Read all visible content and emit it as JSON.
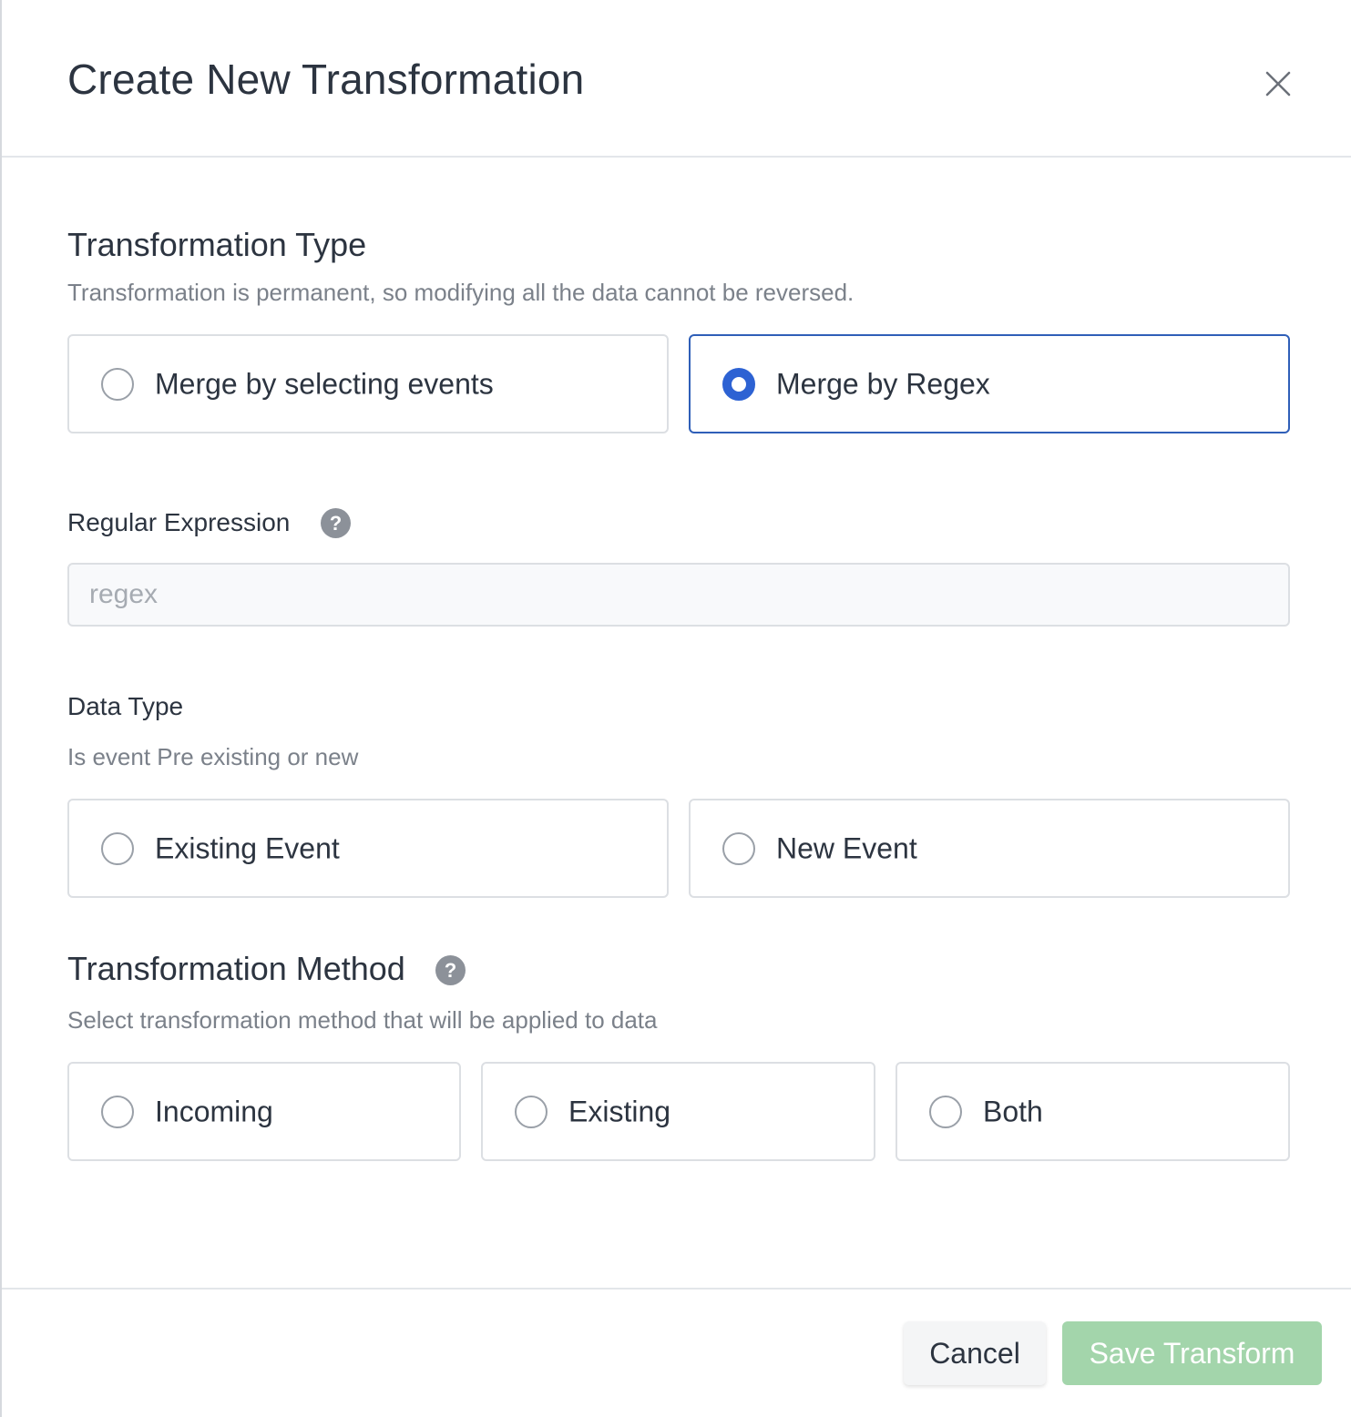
{
  "dialog": {
    "title": "Create New Transformation",
    "close_icon": "close-icon"
  },
  "transformation_type": {
    "title": "Transformation Type",
    "description": "Transformation is permanent, so modifying all the data cannot be reversed.",
    "options": [
      {
        "label": "Merge by selecting events",
        "selected": false
      },
      {
        "label": "Merge by Regex",
        "selected": true
      }
    ]
  },
  "regular_expression": {
    "label": "Regular Expression",
    "help_icon": "?",
    "placeholder": "regex",
    "value": ""
  },
  "data_type": {
    "label": "Data Type",
    "description": "Is event Pre existing or new",
    "options": [
      {
        "label": "Existing Event",
        "selected": false
      },
      {
        "label": "New Event",
        "selected": false
      }
    ]
  },
  "transformation_method": {
    "title": "Transformation Method",
    "help_icon": "?",
    "description": "Select transformation method that will be applied to data",
    "options": [
      {
        "label": "Incoming",
        "selected": false
      },
      {
        "label": "Existing",
        "selected": false
      },
      {
        "label": "Both",
        "selected": false
      }
    ]
  },
  "footer": {
    "cancel_label": "Cancel",
    "save_label": "Save Transform"
  },
  "colors": {
    "accent": "#2d62d3",
    "save_disabled": "#a3d5ab"
  }
}
